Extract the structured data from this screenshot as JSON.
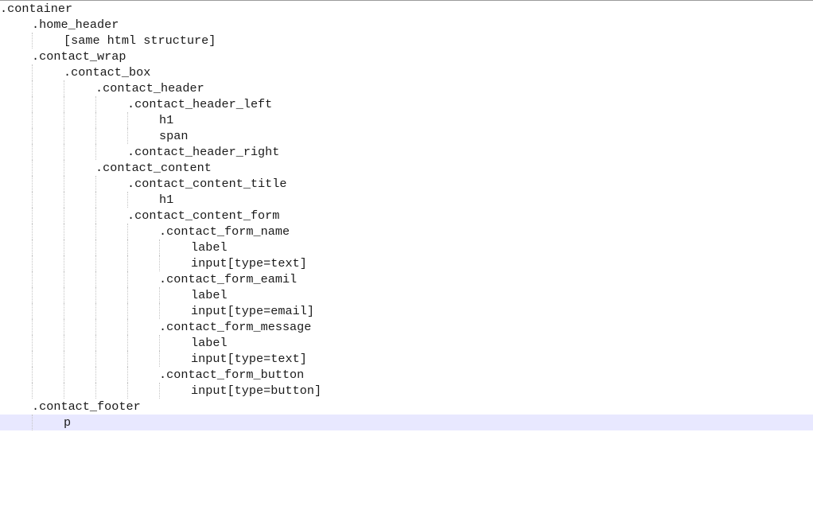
{
  "editor": {
    "lines": [
      {
        "text": ".container"
      },
      {
        "text": ".home_header"
      },
      {
        "text": "[same html structure]"
      },
      {
        "text": ".contact_wrap"
      },
      {
        "text": ".contact_box"
      },
      {
        "text": ".contact_header"
      },
      {
        "text": ".contact_header_left"
      },
      {
        "text": "h1"
      },
      {
        "text": "span"
      },
      {
        "text": ".contact_header_right"
      },
      {
        "text": ".contact_content"
      },
      {
        "text": ".contact_content_title"
      },
      {
        "text": "h1"
      },
      {
        "text": ".contact_content_form"
      },
      {
        "text": ".contact_form_name"
      },
      {
        "text": "label"
      },
      {
        "text": "input[type=text]"
      },
      {
        "text": ".contact_form_eamil"
      },
      {
        "text": "label"
      },
      {
        "text": "input[type=email]"
      },
      {
        "text": ".contact_form_message"
      },
      {
        "text": "label"
      },
      {
        "text": "input[type=text]"
      },
      {
        "text": ".contact_form_button"
      },
      {
        "text": "input[type=button]"
      },
      {
        "text": ".contact_footer"
      },
      {
        "text": "p"
      }
    ]
  }
}
